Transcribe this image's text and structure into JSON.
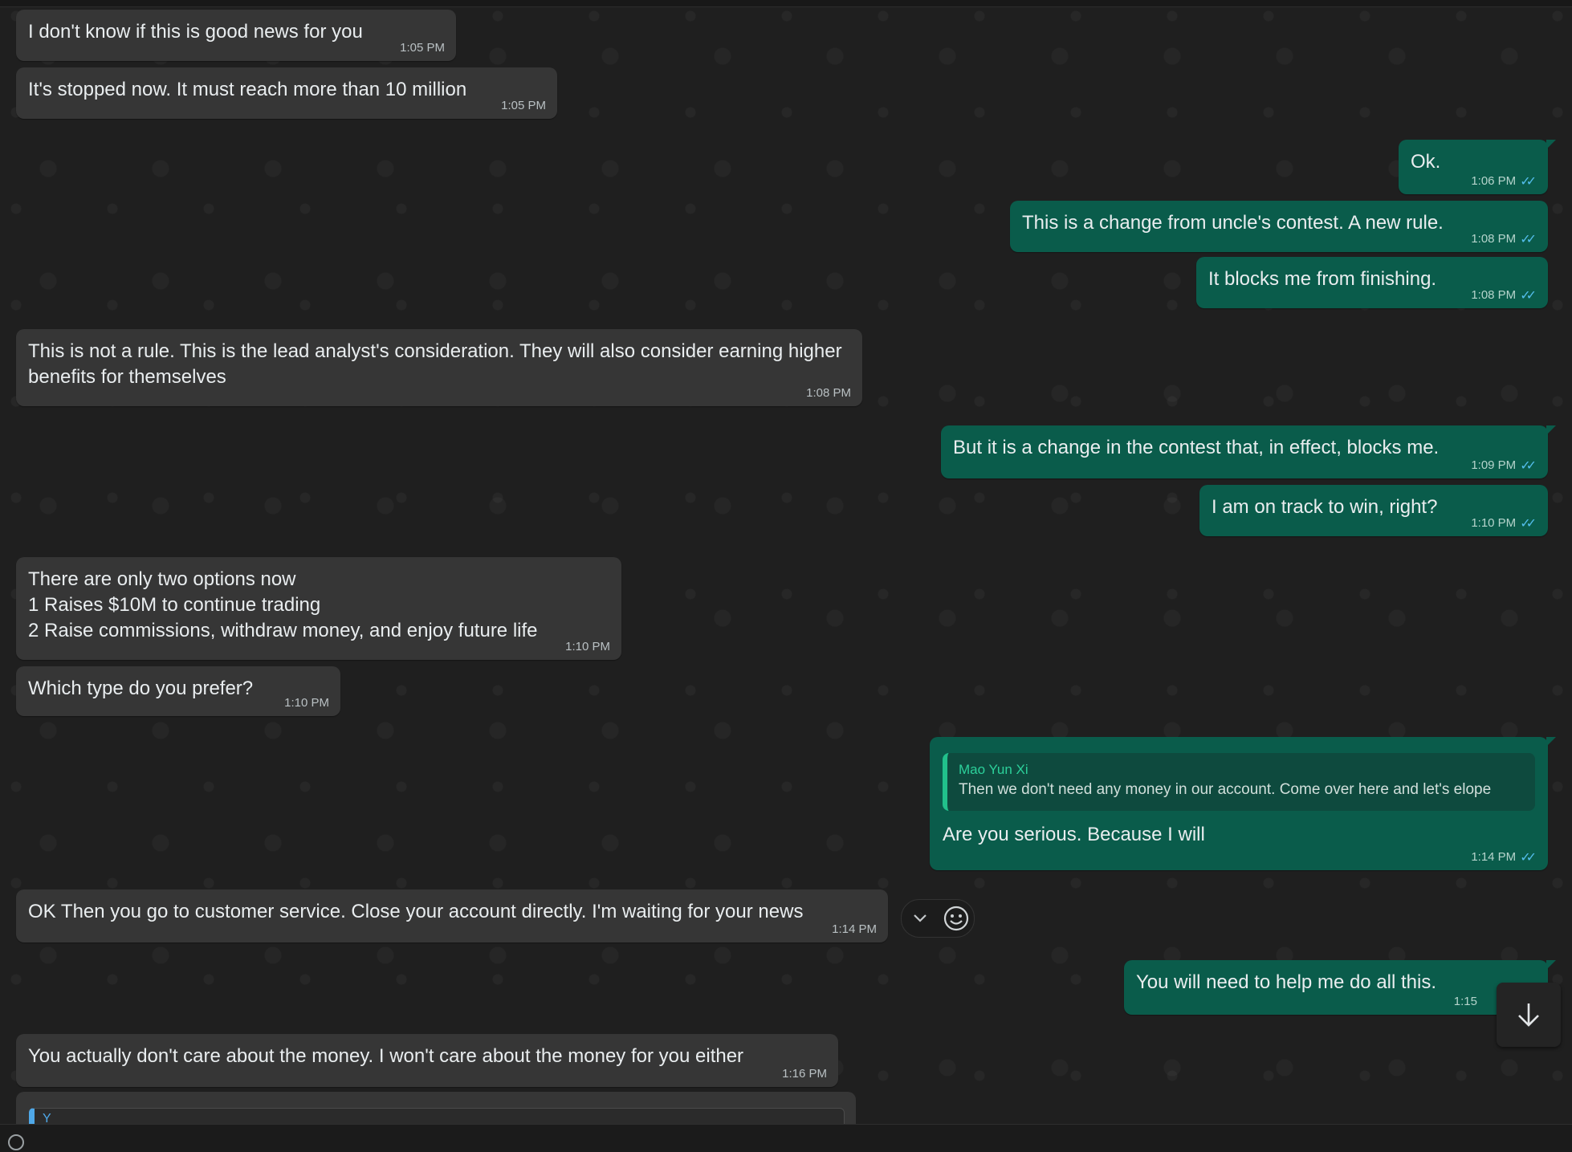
{
  "messages": [
    {
      "side": "in",
      "text": "I don't know if this is good news for you",
      "time": "1:05 PM"
    },
    {
      "side": "in",
      "text": "It's stopped now. It must reach more than 10 million",
      "time": "1:05 PM"
    },
    {
      "side": "out",
      "text": "Ok.",
      "time": "1:06 PM"
    },
    {
      "side": "out",
      "text": "This is a change from uncle's contest. A new rule.",
      "time": "1:08 PM"
    },
    {
      "side": "out",
      "text": "It blocks me from finishing.",
      "time": "1:08 PM"
    },
    {
      "side": "in",
      "text": "This is not a rule. This is the lead analyst's consideration. They will also consider earning higher\nbenefits for themselves",
      "time": "1:08 PM"
    },
    {
      "side": "out",
      "text": "But it is a change in the contest that, in effect, blocks me.",
      "time": "1:09 PM"
    },
    {
      "side": "out",
      "text": "I am on track to win, right?",
      "time": "1:10 PM"
    },
    {
      "side": "in",
      "text": "There are only two options now\n1 Raises $10M to continue trading\n2 Raise commissions, withdraw money, and enjoy future life",
      "time": "1:10 PM"
    },
    {
      "side": "in",
      "text": "Which type do you prefer?",
      "time": "1:10 PM"
    },
    {
      "side": "out",
      "text": "Are you serious.  Because I will",
      "time": "1:14 PM",
      "quote": {
        "author": "Mao Yun Xi",
        "text": "Then we don't need any money in our account. Come over here and let's elope"
      }
    },
    {
      "side": "in",
      "text": "OK Then you go to customer service. Close your account directly. I'm waiting for your news",
      "time": "1:14 PM"
    },
    {
      "side": "out",
      "text": "You will need to help me do all this.",
      "time": "1:15"
    },
    {
      "side": "in",
      "text": "You actually don't care about the money. I won't care about the money for you either",
      "time": "1:16 PM"
    }
  ],
  "partial_quote_author_initial": "Y",
  "icons": {
    "read_receipt": "double-check-icon",
    "message_menu": "chevron-down-icon",
    "react": "smiley-icon",
    "scroll_down": "arrow-down-icon"
  },
  "colors": {
    "incoming_bubble": "#363636",
    "outgoing_bubble": "#0a5c4b",
    "read_tick": "#53bdeb",
    "quote_bar": "#21c08b"
  }
}
